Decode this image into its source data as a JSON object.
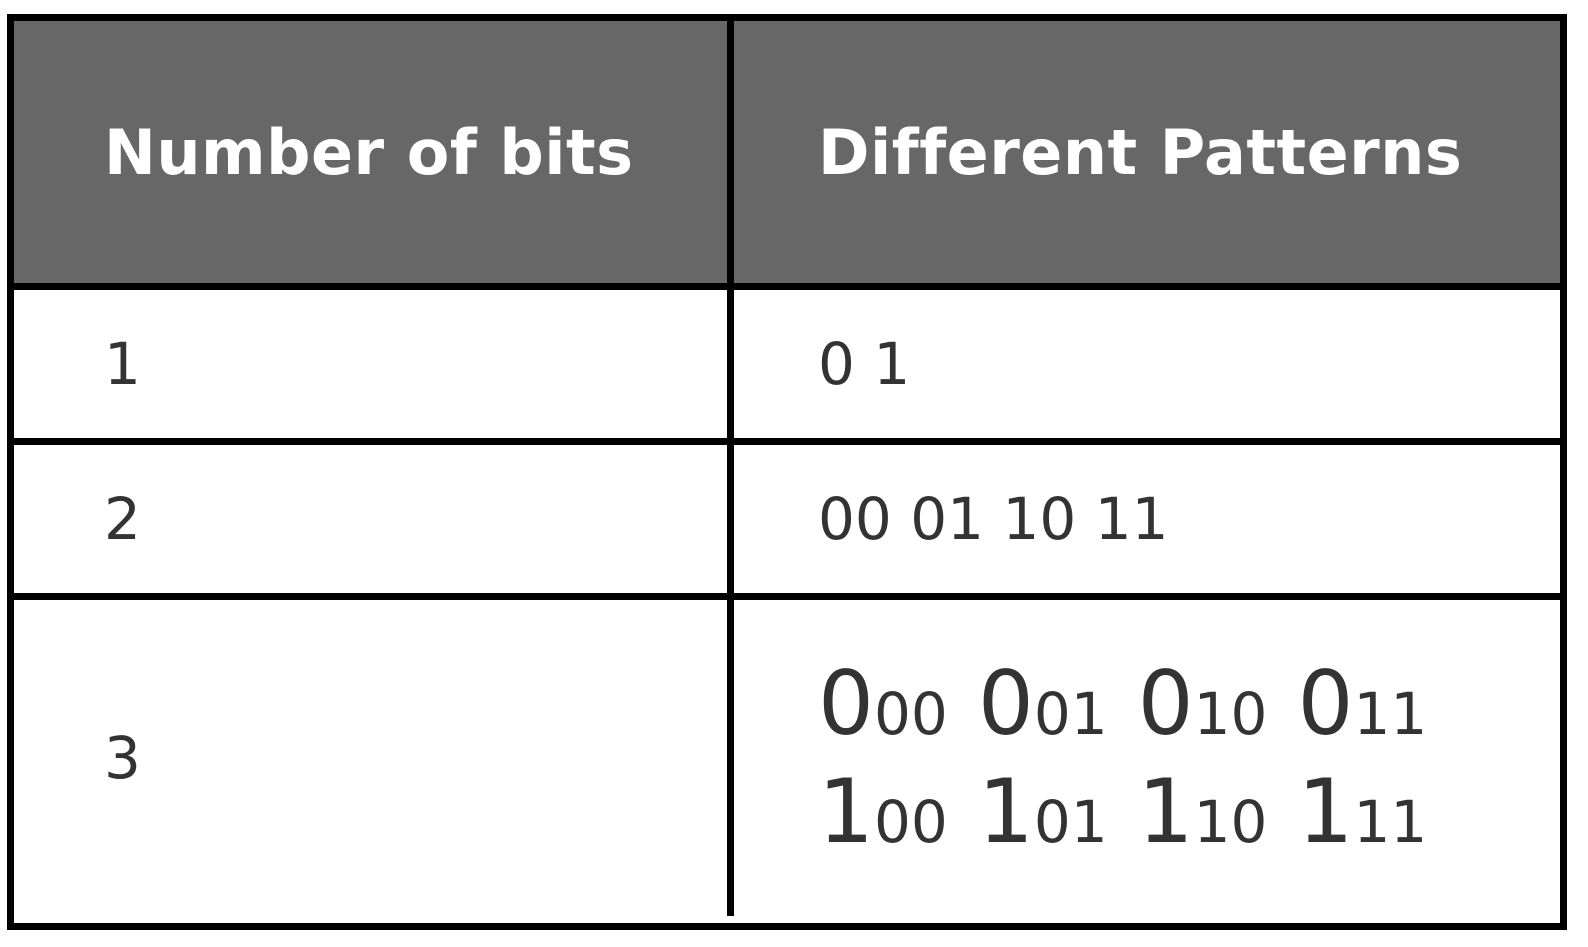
{
  "table": {
    "headers": [
      "Number of bits",
      "Different Patterns"
    ],
    "rows": [
      {
        "bits": "1",
        "patterns": "0 1"
      },
      {
        "bits": "2",
        "patterns": "00 01 10 11"
      },
      {
        "bits": "3",
        "pattern_groups": [
          [
            {
              "lead": "0",
              "rest": "00"
            },
            {
              "lead": "0",
              "rest": "01"
            },
            {
              "lead": "0",
              "rest": "10"
            },
            {
              "lead": "0",
              "rest": "11"
            }
          ],
          [
            {
              "lead": "1",
              "rest": "00"
            },
            {
              "lead": "1",
              "rest": "01"
            },
            {
              "lead": "1",
              "rest": "10"
            },
            {
              "lead": "1",
              "rest": "11"
            }
          ]
        ]
      }
    ]
  },
  "colors": {
    "header_bg": "#676767",
    "header_text": "#ffffff",
    "body_text": "#333333",
    "border": "#000000"
  }
}
